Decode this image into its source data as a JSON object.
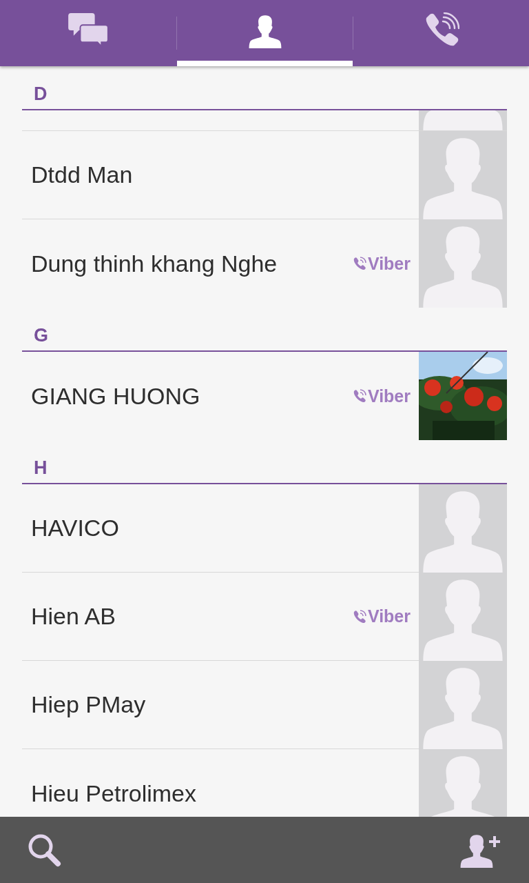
{
  "tabs": [
    {
      "kind": "chats",
      "selected": false
    },
    {
      "kind": "contacts",
      "selected": true
    },
    {
      "kind": "calls",
      "selected": false
    }
  ],
  "sections": [
    {
      "letter": "D",
      "contacts": [
        {
          "cut": true,
          "kind": "silhouette"
        },
        {
          "cut": false,
          "name": "Dtdd Man",
          "kind": "silhouette"
        },
        {
          "cut": false,
          "name": "Dung thinh khang Nghe",
          "badge": "Viber",
          "kind": "silhouette"
        }
      ]
    },
    {
      "letter": "G",
      "contacts": [
        {
          "cut": false,
          "name": "GIANG HUONG",
          "badge": "Viber",
          "kind": "picture"
        }
      ]
    },
    {
      "letter": "H",
      "contacts": [
        {
          "cut": false,
          "name": "HAVICO",
          "kind": "silhouette"
        },
        {
          "cut": false,
          "name": "Hien AB",
          "badge": "Viber",
          "kind": "silhouette"
        },
        {
          "cut": false,
          "name": "Hiep PMay",
          "kind": "silhouette"
        },
        {
          "cut": false,
          "name": "Hieu Petrolimex",
          "kind": "silhouette"
        }
      ]
    }
  ],
  "bottom_bar": {
    "actions": [
      {
        "kind": "search"
      },
      {
        "kind": "add_contact"
      }
    ]
  }
}
